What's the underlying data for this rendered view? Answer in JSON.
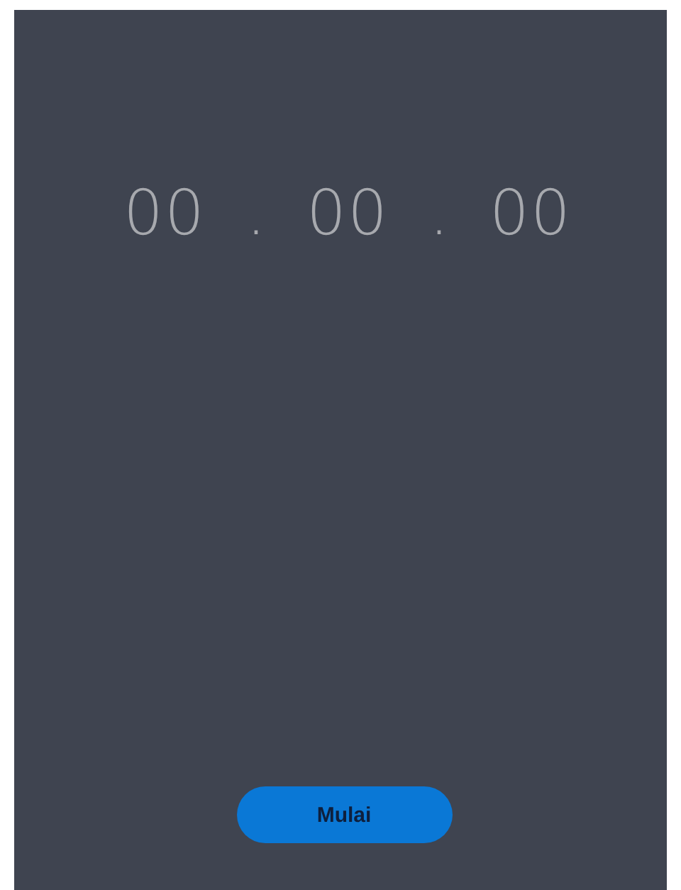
{
  "timer": [
    {
      "kind": "digits",
      "text": "00"
    },
    {
      "kind": "separator",
      "text": "."
    },
    {
      "kind": "digits",
      "text": "00"
    },
    {
      "kind": "separator",
      "text": "."
    },
    {
      "kind": "digits",
      "text": "00"
    }
  ],
  "start_button": {
    "label": "Mulai"
  }
}
